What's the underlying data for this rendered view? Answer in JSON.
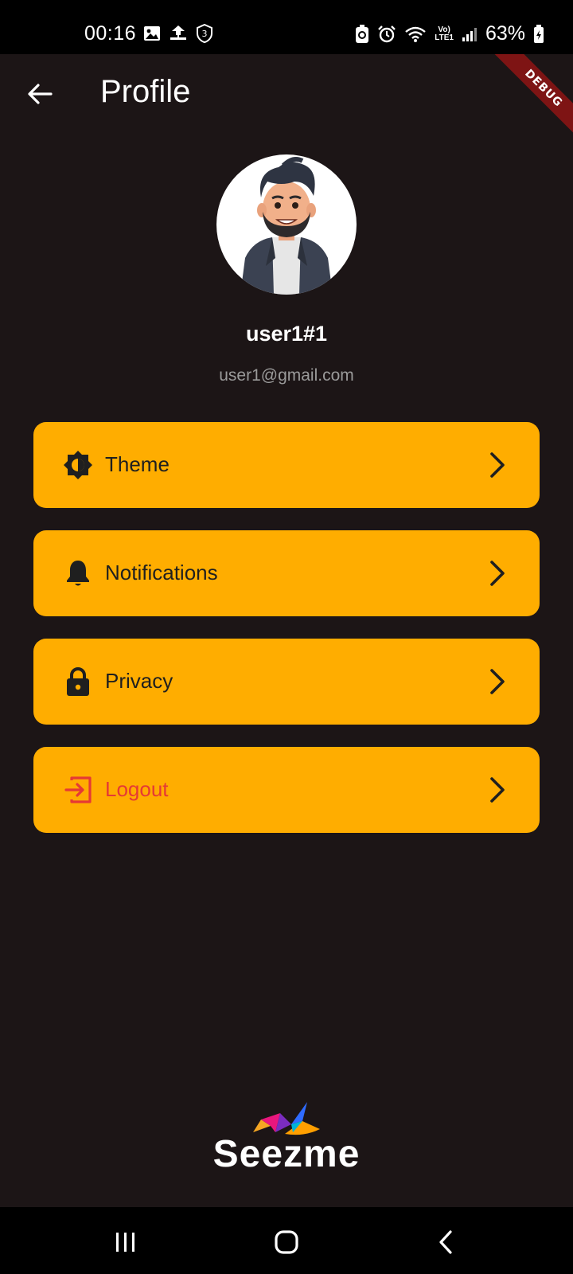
{
  "status_bar": {
    "time": "00:16",
    "battery_percent": "63%",
    "notification_count": "3",
    "network_label": "LTE1",
    "volte_label": "Vo)"
  },
  "debug_banner": {
    "label": "DEBUG"
  },
  "app_bar": {
    "title": "Profile",
    "back_icon": "arrow-left-icon"
  },
  "profile": {
    "name": "user1#1",
    "email": "user1@gmail.com",
    "avatar": "cartoon-man-avatar"
  },
  "menu": {
    "items": [
      {
        "label": "Theme",
        "icon": "brightness-icon"
      },
      {
        "label": "Notifications",
        "icon": "bell-icon"
      },
      {
        "label": "Privacy",
        "icon": "lock-icon"
      },
      {
        "label": "Logout",
        "icon": "logout-icon"
      }
    ],
    "background_color": "#ffad00",
    "logout_color": "#e53935"
  },
  "brand": {
    "name": "Seezme"
  },
  "colors": {
    "background": "#1c1516",
    "email_text": "#9a9a9a"
  }
}
